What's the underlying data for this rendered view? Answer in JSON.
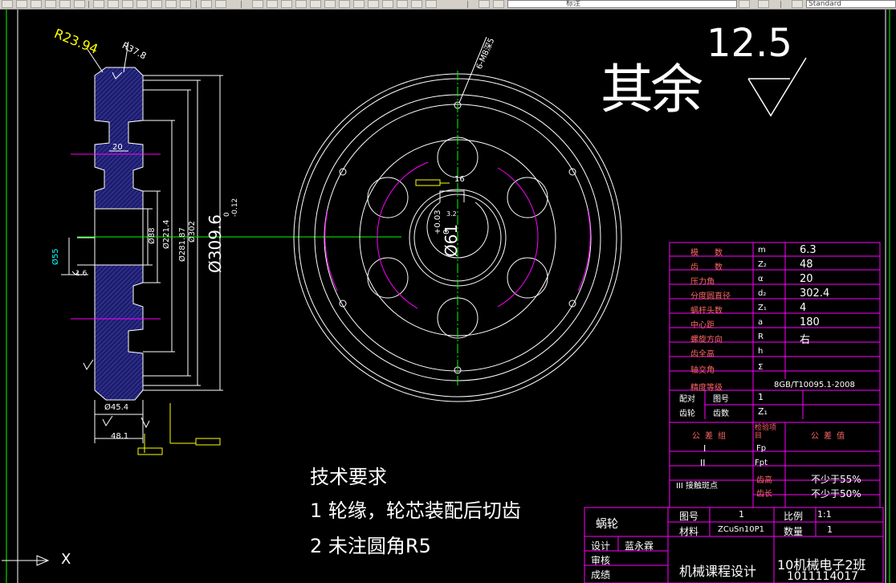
{
  "toolbar": {
    "layer_label": "标注",
    "style_combo": "Standard"
  },
  "drawing": {
    "roughness_other_label": "其余",
    "roughness_value": "12.5",
    "dims": {
      "r_outer": "R23.94",
      "r_rim": "R37.8",
      "width_20": "20",
      "d_outer": "Ø309.6",
      "d_outer_tol": "0\n-0.12",
      "d_302": "Ø302",
      "d_281": "Ø281.87",
      "d_221": "Ø221.4",
      "d_88": "Ø88",
      "d_55": "Ø55",
      "d_hub": "Ø45.4",
      "width_48": "48.1",
      "hole": "6-M8深5",
      "bore": "Ø61",
      "bore_tol": "+0.03\n0",
      "keyway": "16",
      "rough_16": "1.6",
      "rough_32": "3.2"
    },
    "tech_title": "技术要求",
    "tech_items": [
      "1 轮缘，轮芯装配后切齿",
      "2 未注圆角R5"
    ],
    "ucs_x_label": "X",
    "param_table": [
      {
        "name": "模　　数",
        "sym": "m",
        "val": "6.3"
      },
      {
        "name": "齿　　数",
        "sym": "Z₂",
        "val": "48"
      },
      {
        "name": "压力角",
        "sym": "α",
        "val": "20"
      },
      {
        "name": "分度圆直径",
        "sym": "d₂",
        "val": "302.4"
      },
      {
        "name": "蜗杆头数",
        "sym": "Z₁",
        "val": "4"
      },
      {
        "name": "中心距",
        "sym": "a",
        "val": "180"
      },
      {
        "name": "螺旋方向",
        "sym": "R",
        "val": "右"
      },
      {
        "name": "齿全高",
        "sym": "h",
        "val": ""
      },
      {
        "name": "轴交角",
        "sym": "Σ",
        "val": ""
      }
    ],
    "precision_label": "精度等级",
    "precision_value": "8GB/T10095.1-2008",
    "pair_rows": [
      {
        "a": "配对",
        "b": "图号",
        "c": "1"
      },
      {
        "a": "齿轮",
        "b": "齿数",
        "c": "Z₁"
      }
    ],
    "tolerance_header": [
      "公差组",
      "检验项目",
      "公差值"
    ],
    "tolerance_rows": [
      {
        "group": "I",
        "item": "Fp",
        "value": ""
      },
      {
        "group": "II",
        "item": "Fpt",
        "value": ""
      },
      {
        "group": "III 接触斑点",
        "item": "齿高",
        "value": "不少于55%"
      },
      {
        "group": "",
        "item": "齿长",
        "value": "不少于50%"
      }
    ],
    "title_block": {
      "part_name": "蜗轮",
      "drawing_no_label": "图号",
      "drawing_no": "1",
      "scale_label": "比例",
      "scale": "1:1",
      "material_label": "材料",
      "material": "ZCuSn10P1",
      "qty_label": "数量",
      "qty": "1",
      "design_label": "设计",
      "designer": "蓝永霖",
      "check_label": "审核",
      "score_label": "成绩",
      "course": "机械课程设计",
      "class_name": "10机械电子2班",
      "student_no": "1011114017"
    }
  },
  "colors": {
    "bg": "#000000",
    "lines": "#ffffff",
    "table": "#ff00ff",
    "dims": "#ffff00",
    "centerline": "#00ff00",
    "hatch": "#2d2d8c"
  }
}
